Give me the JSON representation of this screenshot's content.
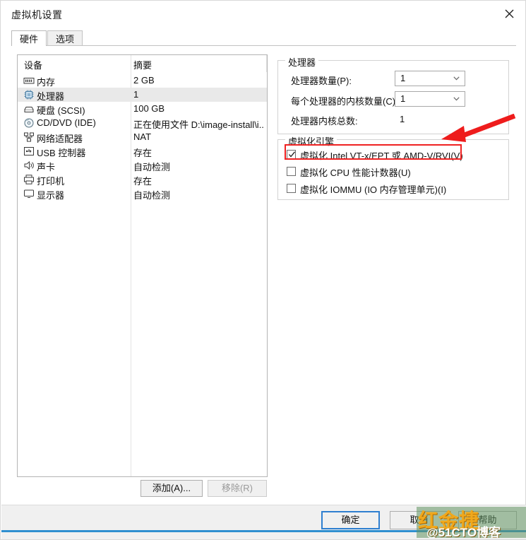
{
  "window": {
    "title": "虚拟机设置",
    "close_icon": "close-icon"
  },
  "tabs": [
    {
      "label": "硬件",
      "active": true
    },
    {
      "label": "选项",
      "active": false
    }
  ],
  "device_list": {
    "columns": {
      "device": "设备",
      "summary": "摘要"
    },
    "rows": [
      {
        "icon": "memory-icon",
        "label": "内存",
        "summary": "2 GB",
        "selected": false
      },
      {
        "icon": "processor-icon",
        "label": "处理器",
        "summary": "1",
        "selected": true
      },
      {
        "icon": "harddisk-icon",
        "label": "硬盘 (SCSI)",
        "summary": "100 GB",
        "selected": false
      },
      {
        "icon": "cddvd-icon",
        "label": "CD/DVD (IDE)",
        "summary": "正在使用文件 D:\\image-install\\i...",
        "selected": false
      },
      {
        "icon": "network-icon",
        "label": "网络适配器",
        "summary": "NAT",
        "selected": false
      },
      {
        "icon": "usb-icon",
        "label": "USB 控制器",
        "summary": "存在",
        "selected": false
      },
      {
        "icon": "sound-icon",
        "label": "声卡",
        "summary": "自动检测",
        "selected": false
      },
      {
        "icon": "printer-icon",
        "label": "打印机",
        "summary": "存在",
        "selected": false
      },
      {
        "icon": "display-icon",
        "label": "显示器",
        "summary": "自动检测",
        "selected": false
      }
    ],
    "add_button": "添加(A)...",
    "remove_button": "移除(R)"
  },
  "processor_group": {
    "title": "处理器",
    "count_label": "处理器数量(P):",
    "count_value": "1",
    "cores_label": "每个处理器的内核数量(C):",
    "cores_value": "1",
    "total_label": "处理器内核总数:",
    "total_value": "1"
  },
  "virtualization_group": {
    "title": "虚拟化引擎",
    "options": [
      {
        "label": "虚拟化 Intel VT-x/EPT 或 AMD-V/RVI(V)",
        "checked": true,
        "highlighted": true
      },
      {
        "label": "虚拟化 CPU 性能计数器(U)",
        "checked": false,
        "highlighted": false
      },
      {
        "label": "虚拟化 IOMMU (IO 内存管理单元)(I)",
        "checked": false,
        "highlighted": false
      }
    ]
  },
  "footer": {
    "ok": "确定",
    "cancel": "取消",
    "help": "帮助"
  },
  "annotation": {
    "arrow_color": "#ee1c1c",
    "highlight_color": "#ef2222"
  },
  "watermark": {
    "big": "红金捷",
    "small": "@51CTO博客"
  }
}
